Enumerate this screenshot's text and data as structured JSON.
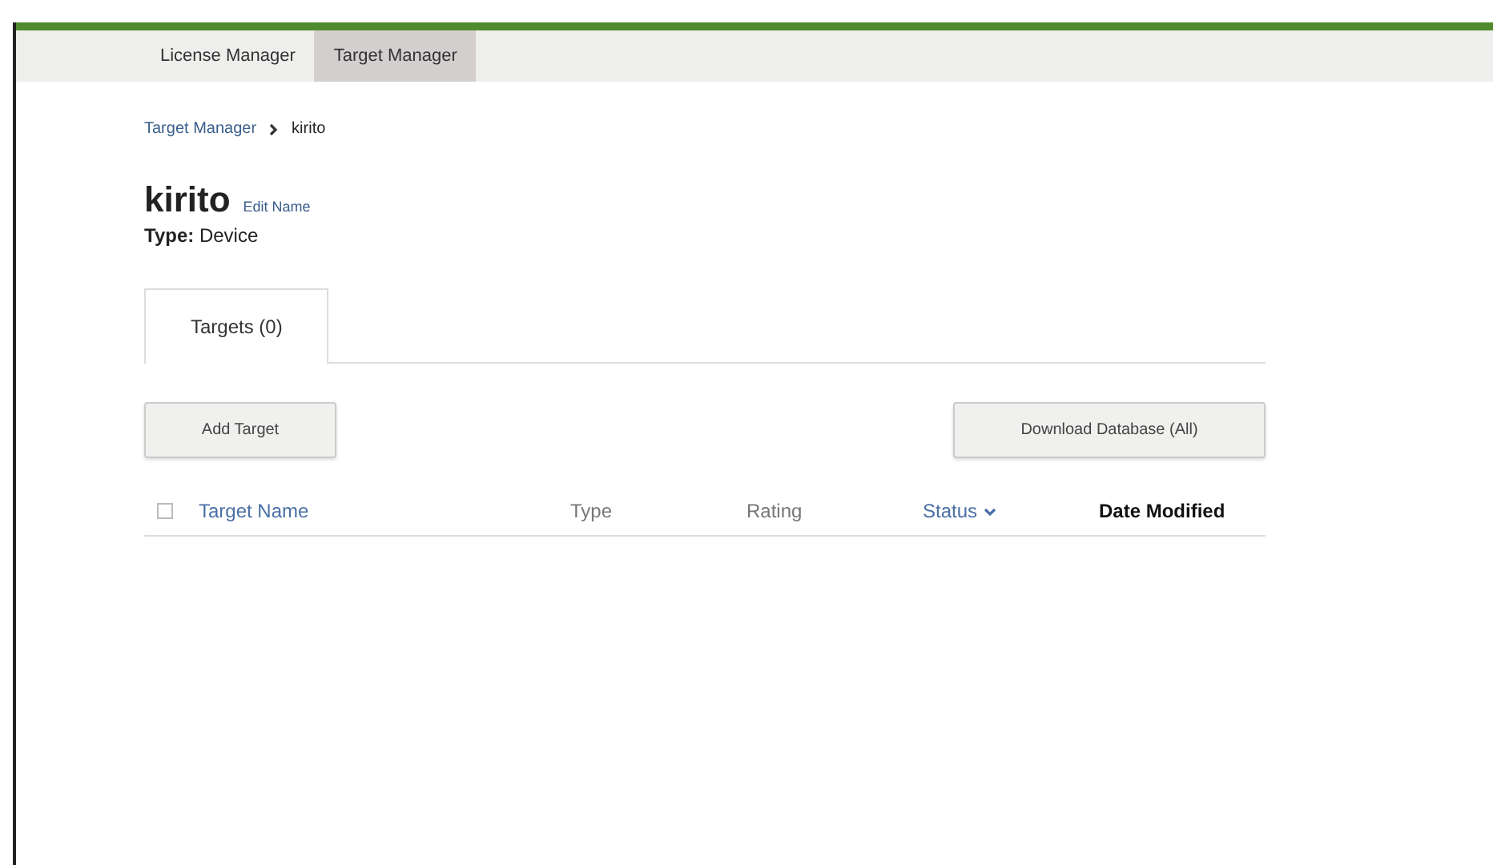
{
  "nav_tabs": [
    {
      "label": "License Manager",
      "selected": false
    },
    {
      "label": "Target Manager",
      "selected": true
    }
  ],
  "breadcrumb": [
    {
      "label": "Target Manager",
      "kind": "link"
    },
    {
      "label": "kirito",
      "kind": "current"
    }
  ],
  "title": "kirito",
  "edit_link": "Edit Name",
  "type_label": "Type:",
  "type_value": "Device",
  "tabs": [
    {
      "label": "Targets (0)",
      "selected": true
    }
  ],
  "buttons": {
    "left": "Add Target",
    "right": "Download Database (All)"
  },
  "table": {
    "select_all_checked": false,
    "columns": [
      {
        "label": "Target Name",
        "kind": "link"
      },
      {
        "label": "Type",
        "kind": "plain"
      },
      {
        "label": "Rating",
        "kind": "plain"
      },
      {
        "label": "Status",
        "kind": "dropdown"
      },
      {
        "label": "Date Modified",
        "kind": "sorted"
      }
    ]
  }
}
